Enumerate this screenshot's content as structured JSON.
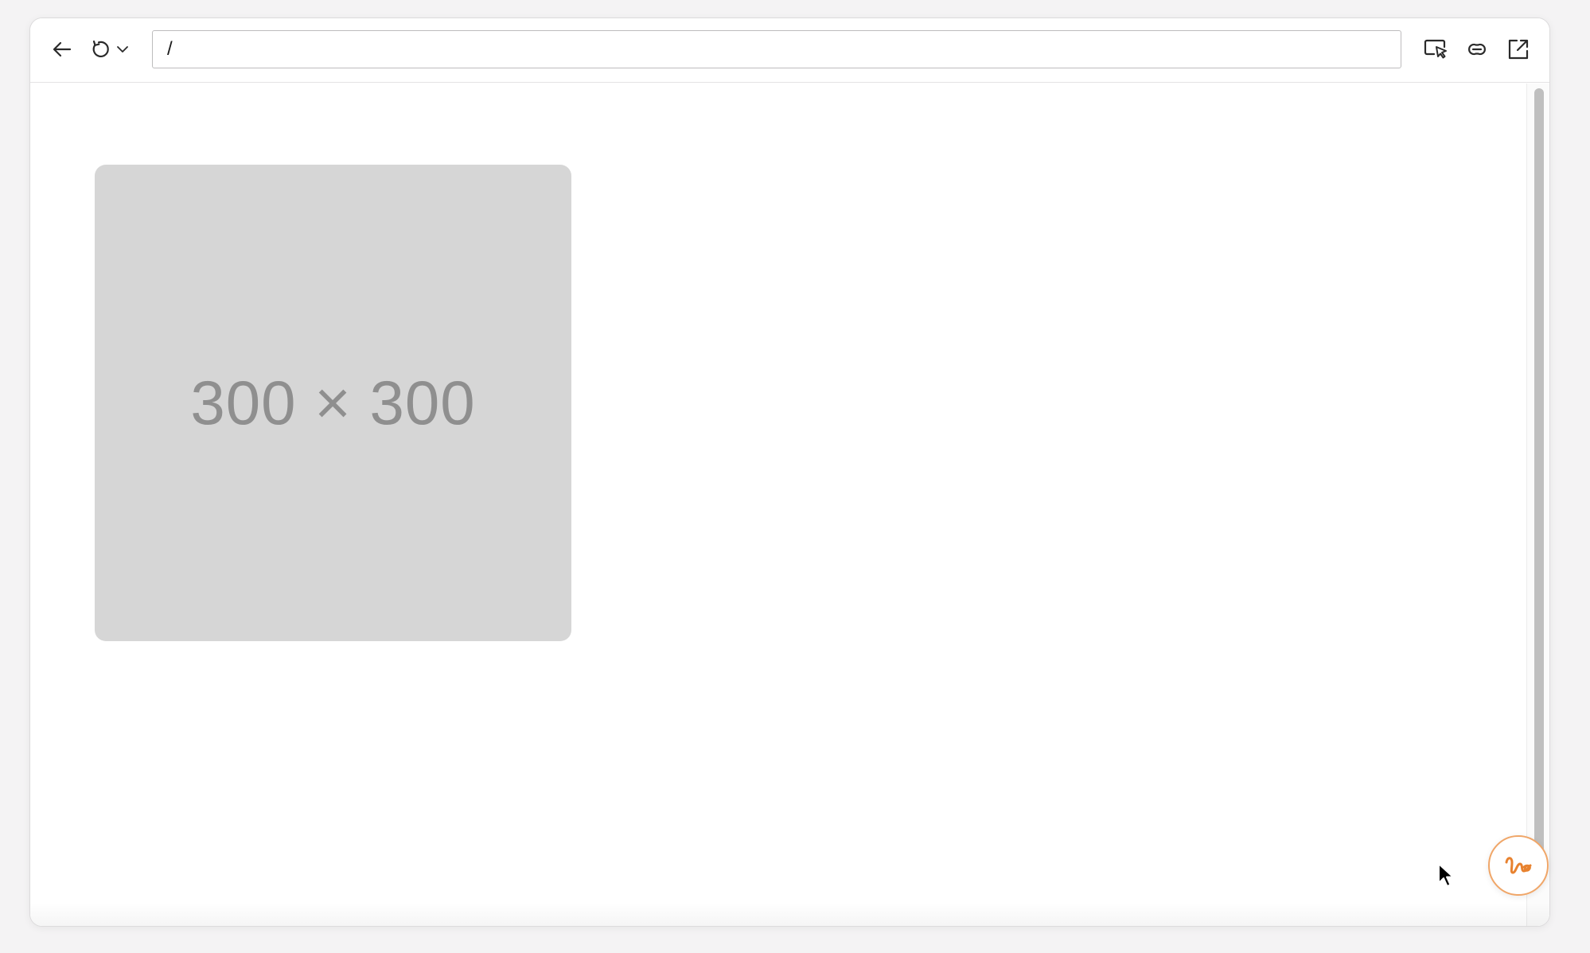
{
  "toolbar": {
    "back_icon": "arrow-left-icon",
    "reload_icon": "reload-icon",
    "reload_menu_icon": "chevron-down-icon",
    "url": "/",
    "inspect_icon": "select-element-icon",
    "link_icon": "link-icon",
    "open_external_icon": "external-link-icon"
  },
  "content": {
    "placeholder_label": "300 × 300"
  },
  "fab": {
    "icon": "scribble-icon",
    "accent_color": "#e8822f"
  }
}
